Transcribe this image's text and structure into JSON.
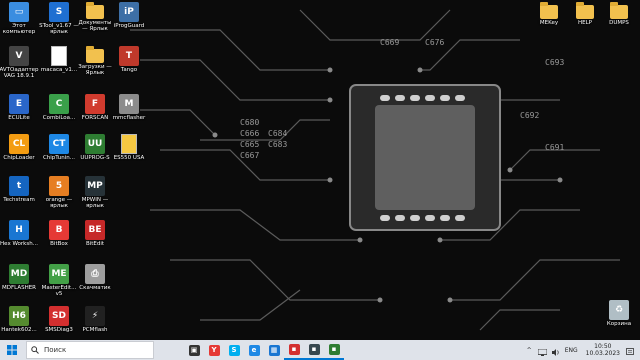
{
  "desktop": {
    "icons": [
      {
        "label": "Этот компьютер",
        "icon": "computer-icon",
        "color": "#3a8de0"
      },
      {
        "label": "STool_v1.67 — ярлык",
        "icon": "stool-icon",
        "color": "#1f6fd1"
      },
      {
        "label": "Документы — Ярлык",
        "icon": "document-folder-icon",
        "color": "#f2c14e"
      },
      {
        "label": "iProgGuard",
        "icon": "iprog-icon",
        "color": "#3d6fa6"
      },
      {
        "label": "AVTOадаптер VAG 18.9.1",
        "icon": "vag-icon",
        "color": "#444444"
      },
      {
        "label": "macaca_v1...",
        "icon": "document-icon",
        "color": "#ffffff"
      },
      {
        "label": "Загрузки — Ярлык",
        "icon": "downloads-folder-icon",
        "color": "#f2c14e"
      },
      {
        "label": "Tango",
        "icon": "tango-icon",
        "color": "#c0392b"
      },
      {
        "label": "ECULite",
        "icon": "eculite-icon",
        "color": "#2a66c9"
      },
      {
        "label": "CombiLoa...",
        "icon": "combiloader-icon",
        "color": "#3aa04a"
      },
      {
        "label": "FORSCAN",
        "icon": "forscan-icon",
        "color": "#d13b2e"
      },
      {
        "label": "mmcflasher",
        "icon": "mmcflasher-icon",
        "color": "#8c8c8c"
      },
      {
        "label": "ChipLoader",
        "icon": "chiploader-icon",
        "color": "#f39c12"
      },
      {
        "label": "ChipTunin...",
        "icon": "chiptuning-icon",
        "color": "#1e88e5"
      },
      {
        "label": "UUPROG-S",
        "icon": "uuprog-icon",
        "color": "#2e7d32"
      },
      {
        "label": "ES550 USA",
        "icon": "document-icon",
        "color": "#f5c842"
      },
      {
        "label": "Techstream",
        "icon": "techstream-icon",
        "color": "#1565c0"
      },
      {
        "label": "orange — ярлык",
        "icon": "orange-icon",
        "color": "#e67e22"
      },
      {
        "label": "MPWIN — ярлык",
        "icon": "mpwin-icon",
        "color": "#263238"
      },
      {
        "label": "Hex Worksh...",
        "icon": "hex-workshop-icon",
        "color": "#1976d2"
      },
      {
        "label": "BitBox",
        "icon": "bitbox-icon",
        "color": "#e53935"
      },
      {
        "label": "BitEdit",
        "icon": "bitedit-icon",
        "color": "#c62828"
      },
      {
        "label": "MDFLASHER",
        "icon": "mdflasher-icon",
        "color": "#2e7d32"
      },
      {
        "label": "MasterEdit... v5",
        "icon": "masteredit-icon",
        "color": "#43a047"
      },
      {
        "label": "Скачматик",
        "icon": "printer-icon",
        "color": "#9e9e9e"
      },
      {
        "label": "Hantek602...",
        "icon": "hantek-icon",
        "color": "#558b2f"
      },
      {
        "label": "SMSDiag3",
        "icon": "smsdiag-icon",
        "color": "#d32f2f"
      },
      {
        "label": "PCMflash",
        "icon": "pcmflash-icon",
        "color": "#212121"
      },
      {
        "label": "MEKey",
        "icon": "folder-icon",
        "color": "#f2c14e"
      },
      {
        "label": "HELP",
        "icon": "folder-icon",
        "color": "#f2c14e"
      },
      {
        "label": "DUMPS",
        "icon": "folder-icon",
        "color": "#f2c14e"
      },
      {
        "label": "Корзина",
        "icon": "recycle-bin-icon",
        "color": "#b0bec5"
      }
    ]
  },
  "taskbar": {
    "search_placeholder": "Поиск",
    "apps": [
      {
        "name": "task-view-icon",
        "color": "#333333",
        "glyph": "▣",
        "active": false
      },
      {
        "name": "yandex-browser-icon",
        "color": "#e53935",
        "glyph": "Y",
        "active": false
      },
      {
        "name": "skype-icon",
        "color": "#00aff0",
        "glyph": "S",
        "active": false
      },
      {
        "name": "edge-icon",
        "color": "#1e88e5",
        "glyph": "e",
        "active": false
      },
      {
        "name": "store-icon",
        "color": "#1976d2",
        "glyph": "▦",
        "active": false
      },
      {
        "name": "diagnostic-app-icon",
        "color": "#d32f2f",
        "glyph": "▪",
        "active": true
      },
      {
        "name": "hex-app-icon",
        "color": "#37474f",
        "glyph": "▪",
        "active": true
      },
      {
        "name": "combiloader-app-icon",
        "color": "#2e7d32",
        "glyph": "▪",
        "active": true
      }
    ],
    "tray": {
      "chevron": "^",
      "language": "ENG",
      "time": "10:50",
      "date": "10.03.2023"
    }
  }
}
